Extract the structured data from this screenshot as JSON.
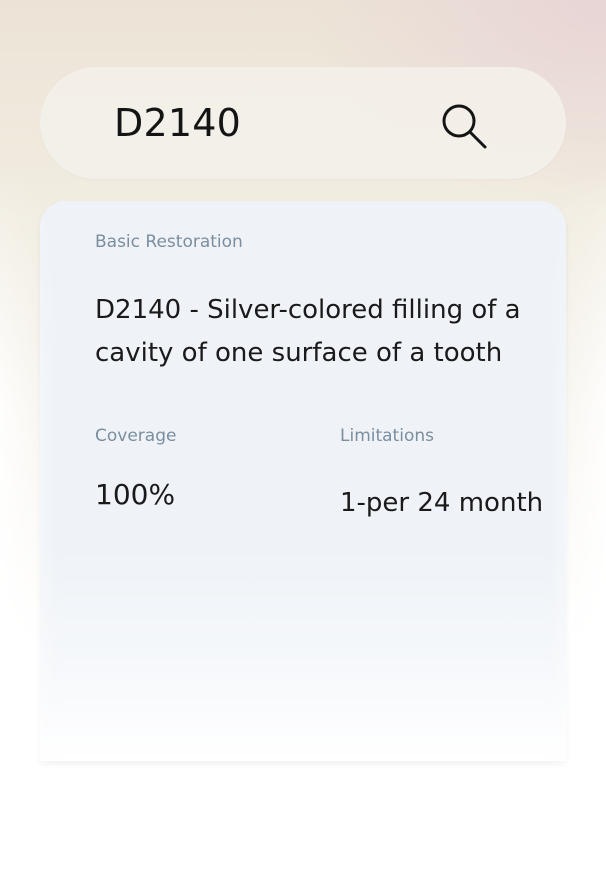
{
  "search": {
    "value": "D2140",
    "icon": "search-icon"
  },
  "result": {
    "category": "Basic Restoration",
    "title": "D2140 - Silver-colored filling of a cavity of one surface of a tooth",
    "coverage": {
      "label": "Coverage",
      "value": "100%"
    },
    "limitations": {
      "label": "Limitations",
      "value": "1-per 24 month"
    }
  }
}
